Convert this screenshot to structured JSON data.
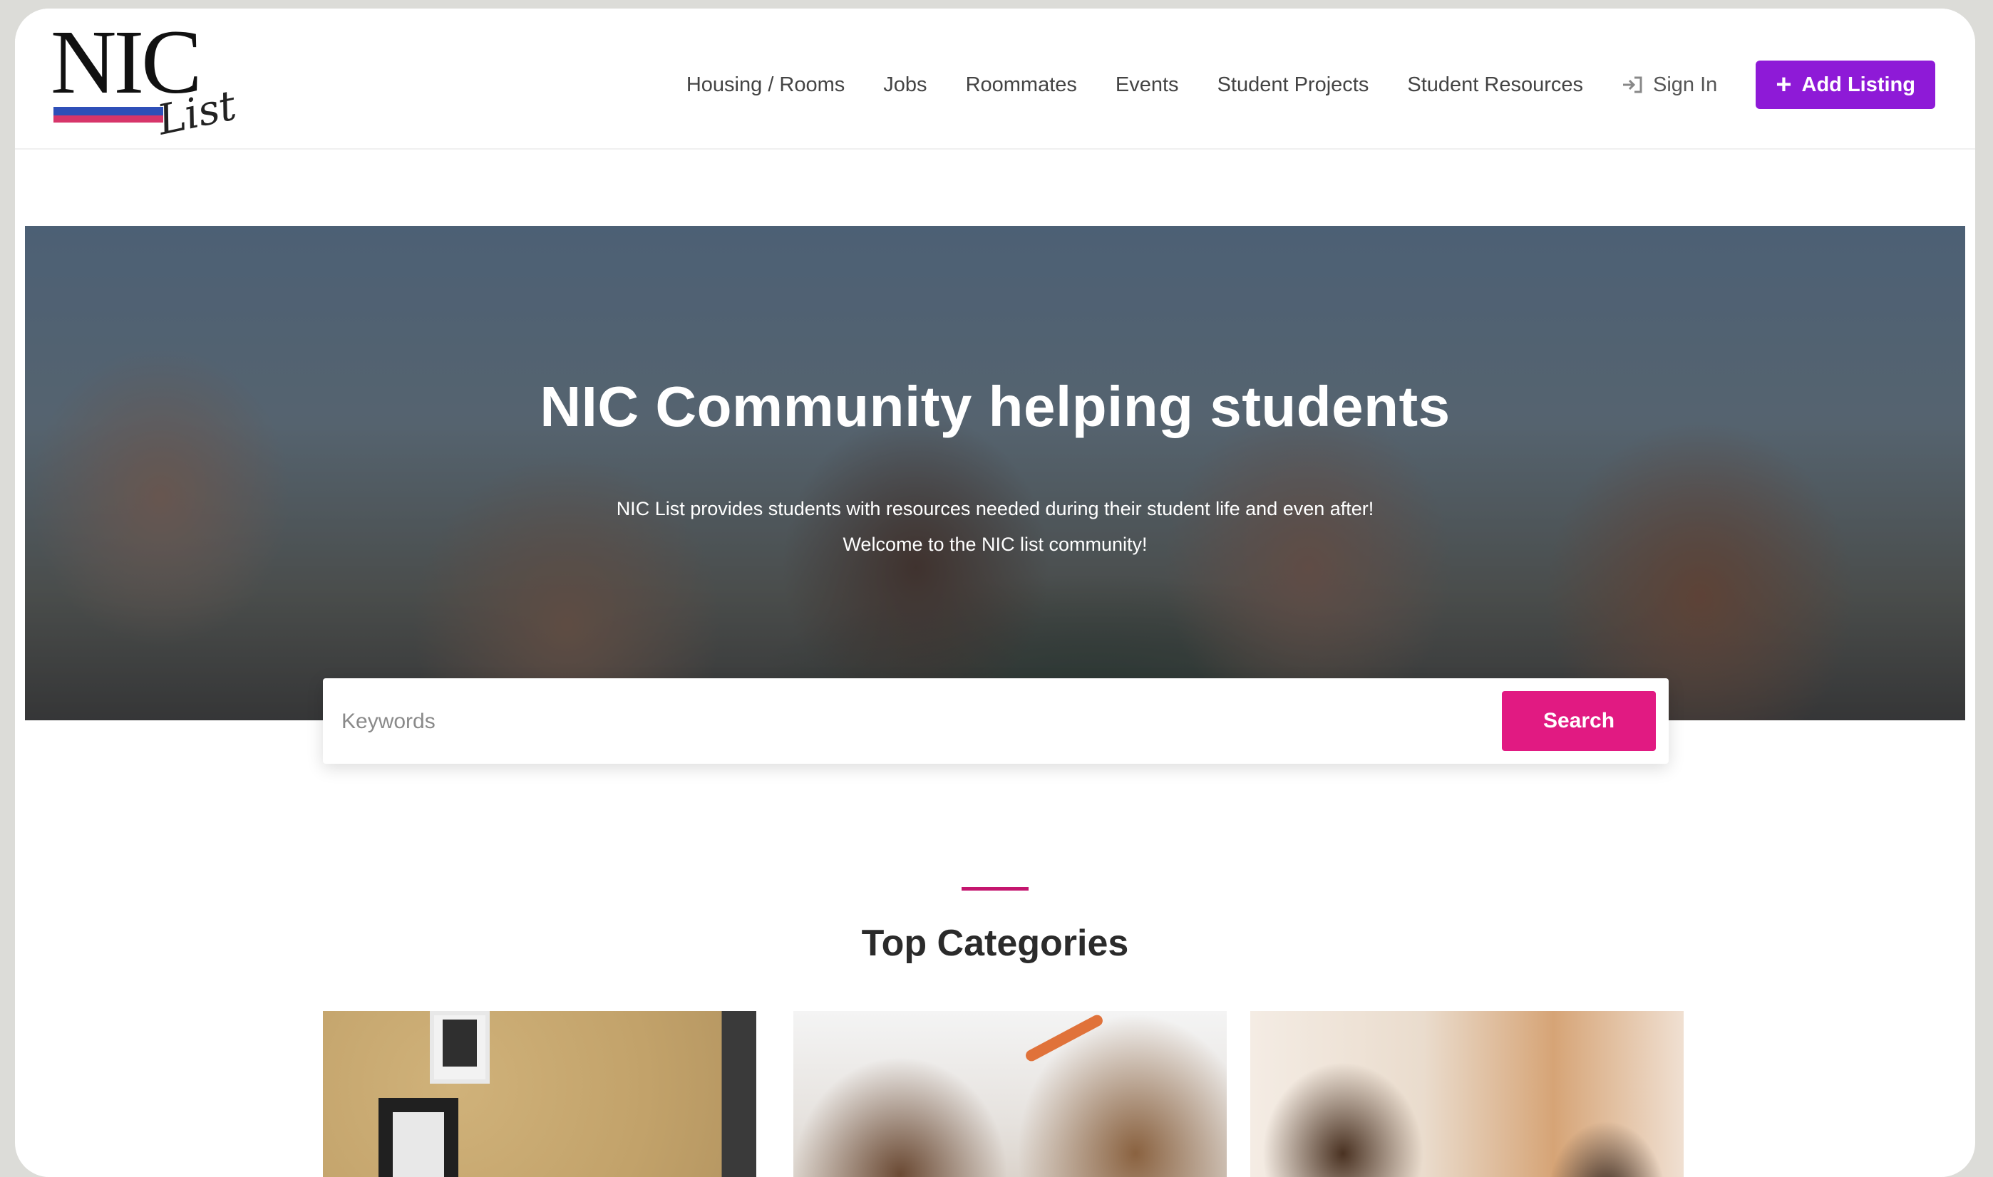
{
  "logo": {
    "main": "NIC",
    "script": "List"
  },
  "nav": {
    "items": [
      {
        "label": "Housing / Rooms"
      },
      {
        "label": "Jobs"
      },
      {
        "label": "Roommates"
      },
      {
        "label": "Events"
      },
      {
        "label": "Student Projects"
      },
      {
        "label": "Student Resources"
      }
    ],
    "sign_in": "Sign In",
    "add_listing": "Add Listing",
    "add_icon": "plus-icon",
    "sign_in_icon": "sign-in-icon"
  },
  "hero": {
    "title": "NIC Community helping students",
    "subtitle_line1": "NIC List provides students with resources needed during their student life and even after!",
    "subtitle_line2": "Welcome to the NIC list community!"
  },
  "search": {
    "placeholder": "Keywords",
    "button": "Search"
  },
  "categories": {
    "title": "Top Categories"
  },
  "colors": {
    "accent_purple": "#8e1ad7",
    "accent_pink": "#e11a82",
    "divider": "#c4156e"
  }
}
